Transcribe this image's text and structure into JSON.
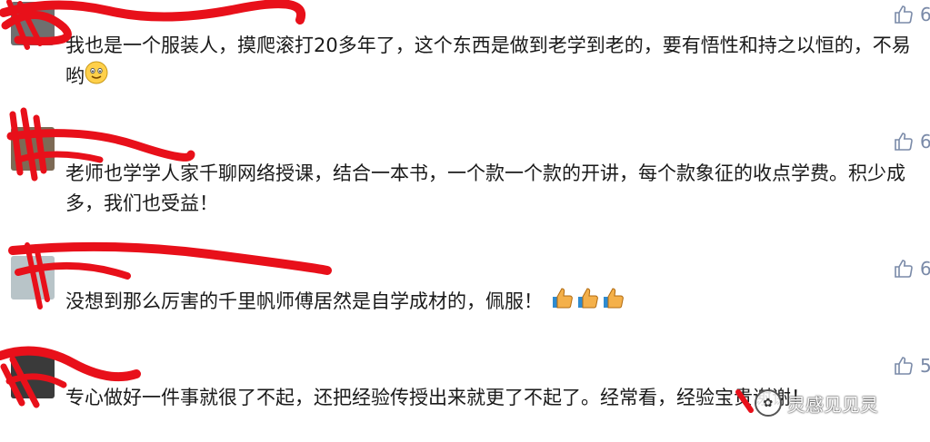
{
  "comments": [
    {
      "nickname": "",
      "likes": "6",
      "text": "我也是一个服装人，摸爬滚打20多年了，这个东西是做到老学到老的，要有悟性和持之以恒的，不易哟",
      "emoji": "smiling-face-emoji"
    },
    {
      "nickname": "",
      "likes": "6",
      "text": "老师也学学人家千聊网络授课，结合一本书，一个款一个款的开讲，每个款象征的收点学费。积少成多，我们也受益！"
    },
    {
      "nickname": "",
      "likes": "6",
      "text": "没想到那么厉害的千里帆师傅居然是自学成材的，佩服！",
      "emoji": "thumbs-up-emoji x3"
    },
    {
      "nickname": "",
      "likes": "5",
      "text": "专心做好一件事就很了不起，还把经验传授出来就更了不起了。经常看，经验宝贵谢谢！"
    }
  ],
  "watermark": {
    "text": "灵感见见灵",
    "icon": "wechat-account-logo"
  },
  "colors": {
    "redaction": "#e8101a",
    "like_icon": "#7a8aa8",
    "text": "#1a1a1a"
  }
}
